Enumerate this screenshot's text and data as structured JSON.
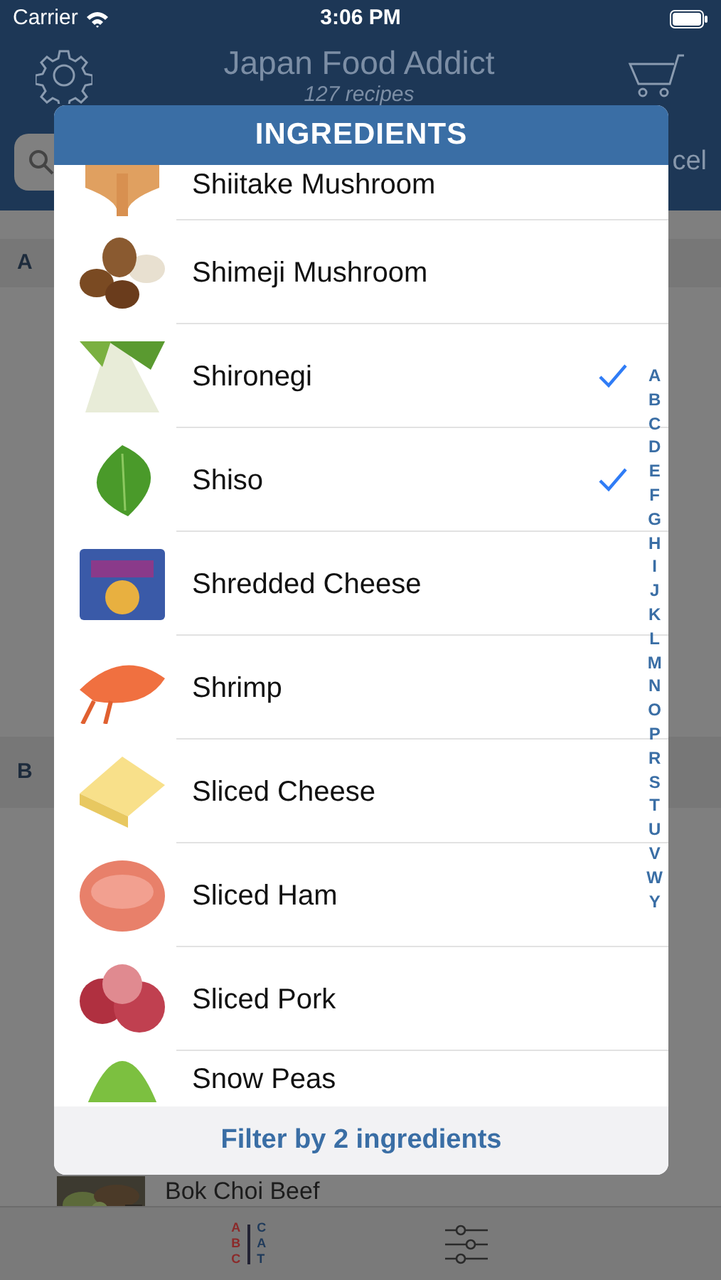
{
  "status_bar": {
    "carrier": "Carrier",
    "time": "3:06 PM"
  },
  "nav": {
    "title": "Japan Food Addict",
    "subtitle": "127 recipes"
  },
  "search": {
    "cancel_label": "cel"
  },
  "sections": [
    {
      "letter": "A"
    },
    {
      "letter": "B"
    }
  ],
  "recipe_rows": [
    {
      "name": "Bok Choi Beef"
    }
  ],
  "tab_bar": {
    "abc_letters": [
      "A",
      "B",
      "C"
    ],
    "cat_letters": [
      "C",
      "A",
      "T"
    ]
  },
  "modal": {
    "title": "INGREDIENTS",
    "items": [
      {
        "name": "Shiitake Mushroom",
        "checked": false
      },
      {
        "name": "Shimeji Mushroom",
        "checked": false
      },
      {
        "name": "Shironegi",
        "checked": true
      },
      {
        "name": "Shiso",
        "checked": true
      },
      {
        "name": "Shredded Cheese",
        "checked": false
      },
      {
        "name": "Shrimp",
        "checked": false
      },
      {
        "name": "Sliced Cheese",
        "checked": false
      },
      {
        "name": "Sliced Ham",
        "checked": false
      },
      {
        "name": "Sliced Pork",
        "checked": false
      },
      {
        "name": "Snow Peas",
        "checked": false
      }
    ],
    "index_letters": [
      "A",
      "B",
      "C",
      "D",
      "E",
      "F",
      "G",
      "H",
      "I",
      "J",
      "K",
      "L",
      "M",
      "N",
      "O",
      "P",
      "R",
      "S",
      "T",
      "U",
      "V",
      "W",
      "Y"
    ],
    "filter_button": "Filter by 2 ingredients"
  }
}
